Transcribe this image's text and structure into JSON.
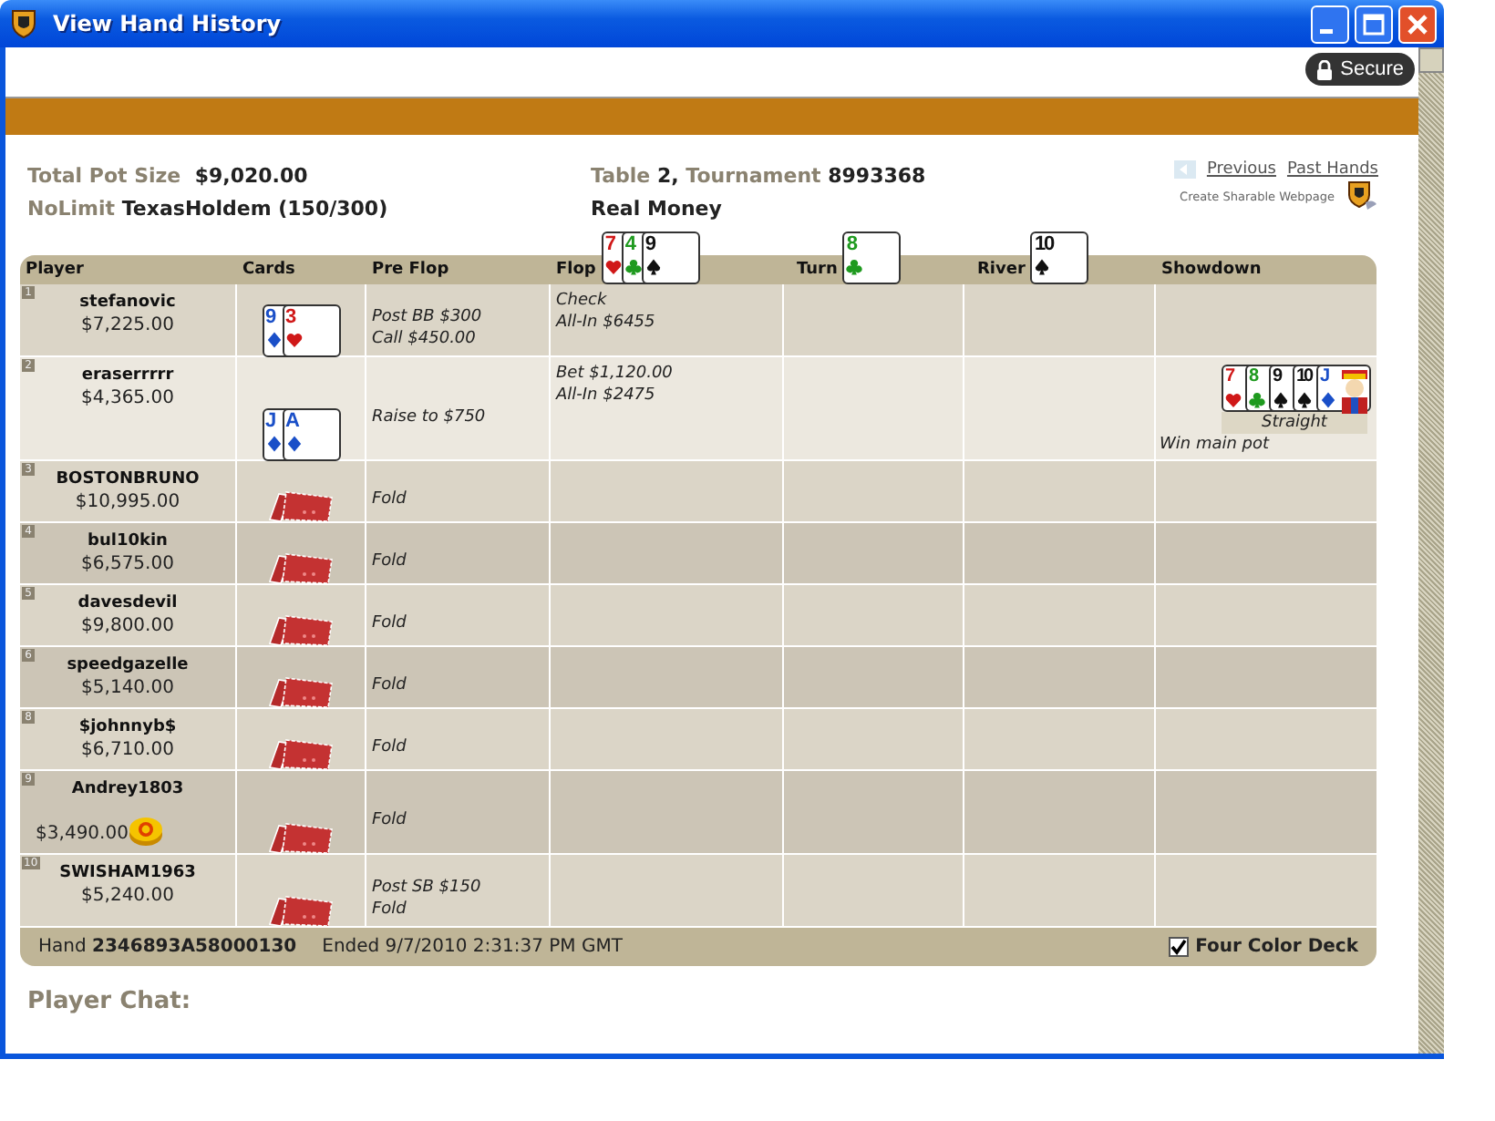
{
  "window": {
    "title": "View Hand History"
  },
  "secure_badge": "Secure",
  "summary": {
    "pot_label": "Total Pot Size",
    "pot": "$9,020.00",
    "limit": "NoLimit",
    "game": "TexasHoldem (150/300)",
    "table_label": "Table",
    "table": "2,",
    "tournament_label": "Tournament",
    "tournament": "8993368",
    "money": "Real Money"
  },
  "nav": {
    "previous": "Previous",
    "past_hands": "Past Hands",
    "share": "Create Sharable Webpage"
  },
  "table": {
    "columns": [
      {
        "label": "Player"
      },
      {
        "label": "Cards"
      },
      {
        "label": "Pre Flop"
      },
      {
        "label": "Flop",
        "cards": [
          {
            "rank": "7",
            "kind": "hearts"
          },
          {
            "rank": "4",
            "kind": "clubs"
          },
          {
            "rank": "9",
            "kind": "spades"
          }
        ]
      },
      {
        "label": "Turn",
        "cards": [
          {
            "rank": "8",
            "kind": "clubs"
          }
        ]
      },
      {
        "label": "River",
        "cards": [
          {
            "rank": "10",
            "kind": "spades"
          }
        ]
      },
      {
        "label": "Showdown"
      }
    ],
    "rows": [
      {
        "seat": "1",
        "name": "stefanovic",
        "stack": "$7,225.00",
        "dealer": false,
        "winner": false,
        "folded": false,
        "cards": [
          {
            "rank": "9",
            "kind": "diamonds"
          },
          {
            "rank": "3",
            "kind": "hearts"
          }
        ],
        "preflop": [
          "Post BB $300",
          "Call $450.00"
        ],
        "flop": [
          "Check",
          "All-In $6455"
        ]
      },
      {
        "seat": "2",
        "name": "eraserrrrr",
        "stack": "$4,365.00",
        "dealer": false,
        "winner": true,
        "folded": false,
        "cards": [
          {
            "rank": "J",
            "kind": "diamonds"
          },
          {
            "rank": "A",
            "kind": "diamonds"
          }
        ],
        "preflop": [
          "Raise to $750"
        ],
        "flop": [
          "Bet $1,120.00",
          "All-In $2475"
        ],
        "showdown": {
          "cards": [
            {
              "rank": "7",
              "kind": "hearts"
            },
            {
              "rank": "8",
              "kind": "clubs"
            },
            {
              "rank": "9",
              "kind": "spades"
            },
            {
              "rank": "10",
              "kind": "spades"
            },
            {
              "rank": "J",
              "kind": "diamonds",
              "court": true
            }
          ],
          "hand": "Straight",
          "result": "Win main pot"
        }
      },
      {
        "seat": "3",
        "name": "BOSTONBRUNO",
        "stack": "$10,995.00",
        "dealer": false,
        "winner": false,
        "folded": true,
        "preflop": [
          "Fold"
        ]
      },
      {
        "seat": "4",
        "name": "bul10kin",
        "stack": "$6,575.00",
        "dealer": false,
        "winner": false,
        "folded": true,
        "preflop": [
          "Fold"
        ]
      },
      {
        "seat": "5",
        "name": "davesdevil",
        "stack": "$9,800.00",
        "dealer": false,
        "winner": false,
        "folded": true,
        "preflop": [
          "Fold"
        ]
      },
      {
        "seat": "6",
        "name": "speedgazelle",
        "stack": "$5,140.00",
        "dealer": false,
        "winner": false,
        "folded": true,
        "preflop": [
          "Fold"
        ]
      },
      {
        "seat": "8",
        "name": "$johnnyb$",
        "stack": "$6,710.00",
        "dealer": false,
        "winner": false,
        "folded": true,
        "preflop": [
          "Fold"
        ]
      },
      {
        "seat": "9",
        "name": "Andrey1803",
        "stack": "$3,490.00",
        "dealer": true,
        "winner": false,
        "folded": true,
        "preflop": [
          "Fold"
        ]
      },
      {
        "seat": "10",
        "name": "SWISHAM1963",
        "stack": "$5,240.00",
        "dealer": false,
        "winner": false,
        "folded": true,
        "preflop": [
          "Post SB $150",
          "Fold"
        ]
      }
    ]
  },
  "footer": {
    "hand_label": "Hand",
    "hand": "2346893A58000130",
    "ended": "Ended 9/7/2010 2:31:37 PM GMT",
    "four_color_deck": {
      "label": "Four Color Deck",
      "checked": true
    }
  },
  "chat": {
    "label": "Player Chat:"
  }
}
